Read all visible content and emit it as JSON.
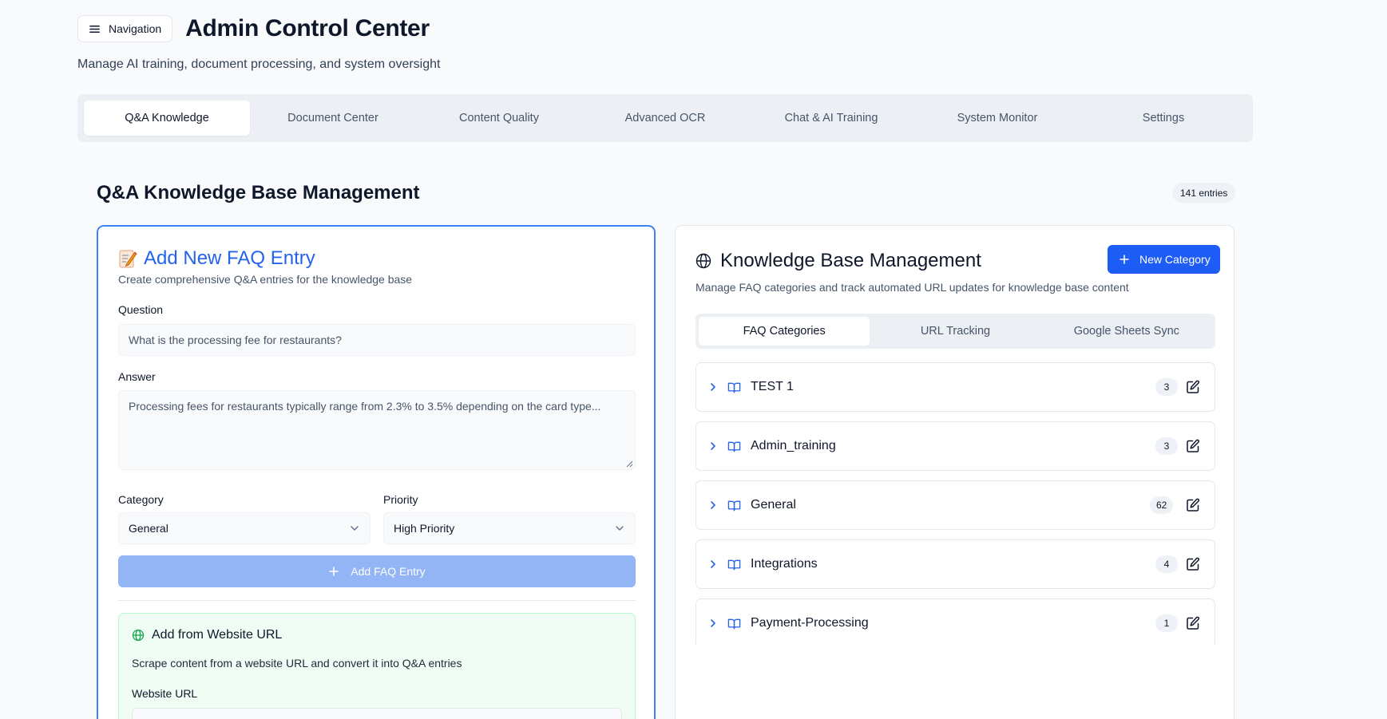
{
  "header": {
    "nav_label": "Navigation",
    "title": "Admin Control Center",
    "subtitle": "Manage AI training, document processing, and system oversight"
  },
  "main_tabs": [
    {
      "label": "Q&A Knowledge",
      "active": true
    },
    {
      "label": "Document Center",
      "active": false
    },
    {
      "label": "Content Quality",
      "active": false
    },
    {
      "label": "Advanced OCR",
      "active": false
    },
    {
      "label": "Chat & AI Training",
      "active": false
    },
    {
      "label": "System Monitor",
      "active": false
    },
    {
      "label": "Settings",
      "active": false
    }
  ],
  "section": {
    "title": "Q&A Knowledge Base Management",
    "entries_badge": "141 entries"
  },
  "add_faq": {
    "title": "Add New FAQ Entry",
    "description": "Create comprehensive Q&A entries for the knowledge base",
    "question_label": "Question",
    "question_placeholder": "What is the processing fee for restaurants?",
    "answer_label": "Answer",
    "answer_placeholder": "Processing fees for restaurants typically range from 2.3% to 3.5% depending on the card type...",
    "category_label": "Category",
    "category_value": "General",
    "priority_label": "Priority",
    "priority_value": "High Priority",
    "submit_label": "Add FAQ Entry"
  },
  "url_import": {
    "title": "Add from Website URL",
    "description": "Scrape content from a website URL and convert it into Q&A entries",
    "url_label": "Website URL"
  },
  "kb": {
    "title": "Knowledge Base Management",
    "new_category_label": "New Category",
    "description": "Manage FAQ categories and track automated URL updates for knowledge base content",
    "sub_tabs": [
      {
        "label": "FAQ Categories",
        "active": true
      },
      {
        "label": "URL Tracking",
        "active": false
      },
      {
        "label": "Google Sheets Sync",
        "active": false
      }
    ],
    "categories": [
      {
        "name": "TEST 1",
        "count": "3"
      },
      {
        "name": "Admin_training",
        "count": "3"
      },
      {
        "name": "General",
        "count": "62"
      },
      {
        "name": "Integrations",
        "count": "4"
      },
      {
        "name": "Payment-Processing",
        "count": "1"
      }
    ]
  },
  "colors": {
    "accent": "#2563eb",
    "primary_button": "#1d5cf5",
    "disabled_button": "#93b4f5",
    "success_bg": "#f0fdf4"
  }
}
